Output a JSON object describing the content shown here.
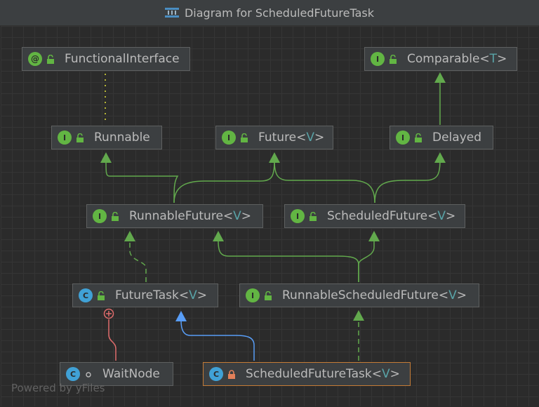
{
  "window": {
    "title": "Diagram for ScheduledFutureTask"
  },
  "nodes": {
    "functional_interface": {
      "name": "FunctionalInterface",
      "kind": "annotation"
    },
    "comparable": {
      "name": "Comparable",
      "type_param": "T",
      "kind": "interface"
    },
    "runnable": {
      "name": "Runnable",
      "kind": "interface"
    },
    "future": {
      "name": "Future",
      "type_param": "V",
      "kind": "interface"
    },
    "delayed": {
      "name": "Delayed",
      "kind": "interface"
    },
    "runnable_future": {
      "name": "RunnableFuture",
      "type_param": "V",
      "kind": "interface"
    },
    "scheduled_future": {
      "name": "ScheduledFuture",
      "type_param": "V",
      "kind": "interface"
    },
    "future_task": {
      "name": "FutureTask",
      "type_param": "V",
      "kind": "class"
    },
    "runnable_scheduled_future": {
      "name": "RunnableScheduledFuture",
      "type_param": "V",
      "kind": "interface"
    },
    "wait_node": {
      "name": "WaitNode",
      "kind": "class"
    },
    "scheduled_future_task": {
      "name": "ScheduledFutureTask",
      "type_param": "V",
      "kind": "class",
      "selected": true
    }
  },
  "badges": {
    "interface": "I",
    "annotation": "@",
    "class": "C"
  },
  "footer": {
    "text": "Powered by yFiles"
  },
  "colors": {
    "background": "#2b2b2b",
    "node_bg": "#3c3f41",
    "node_border": "#5e6060",
    "selected_border": "#c57b36",
    "extends_edge": "#62a94d",
    "implements_edge": "#62a94d",
    "class_extends_edge": "#589df6",
    "inner_class_edge": "#e06c6c",
    "annotation_edge": "#b5b536",
    "type_param": "#59a3a7"
  }
}
